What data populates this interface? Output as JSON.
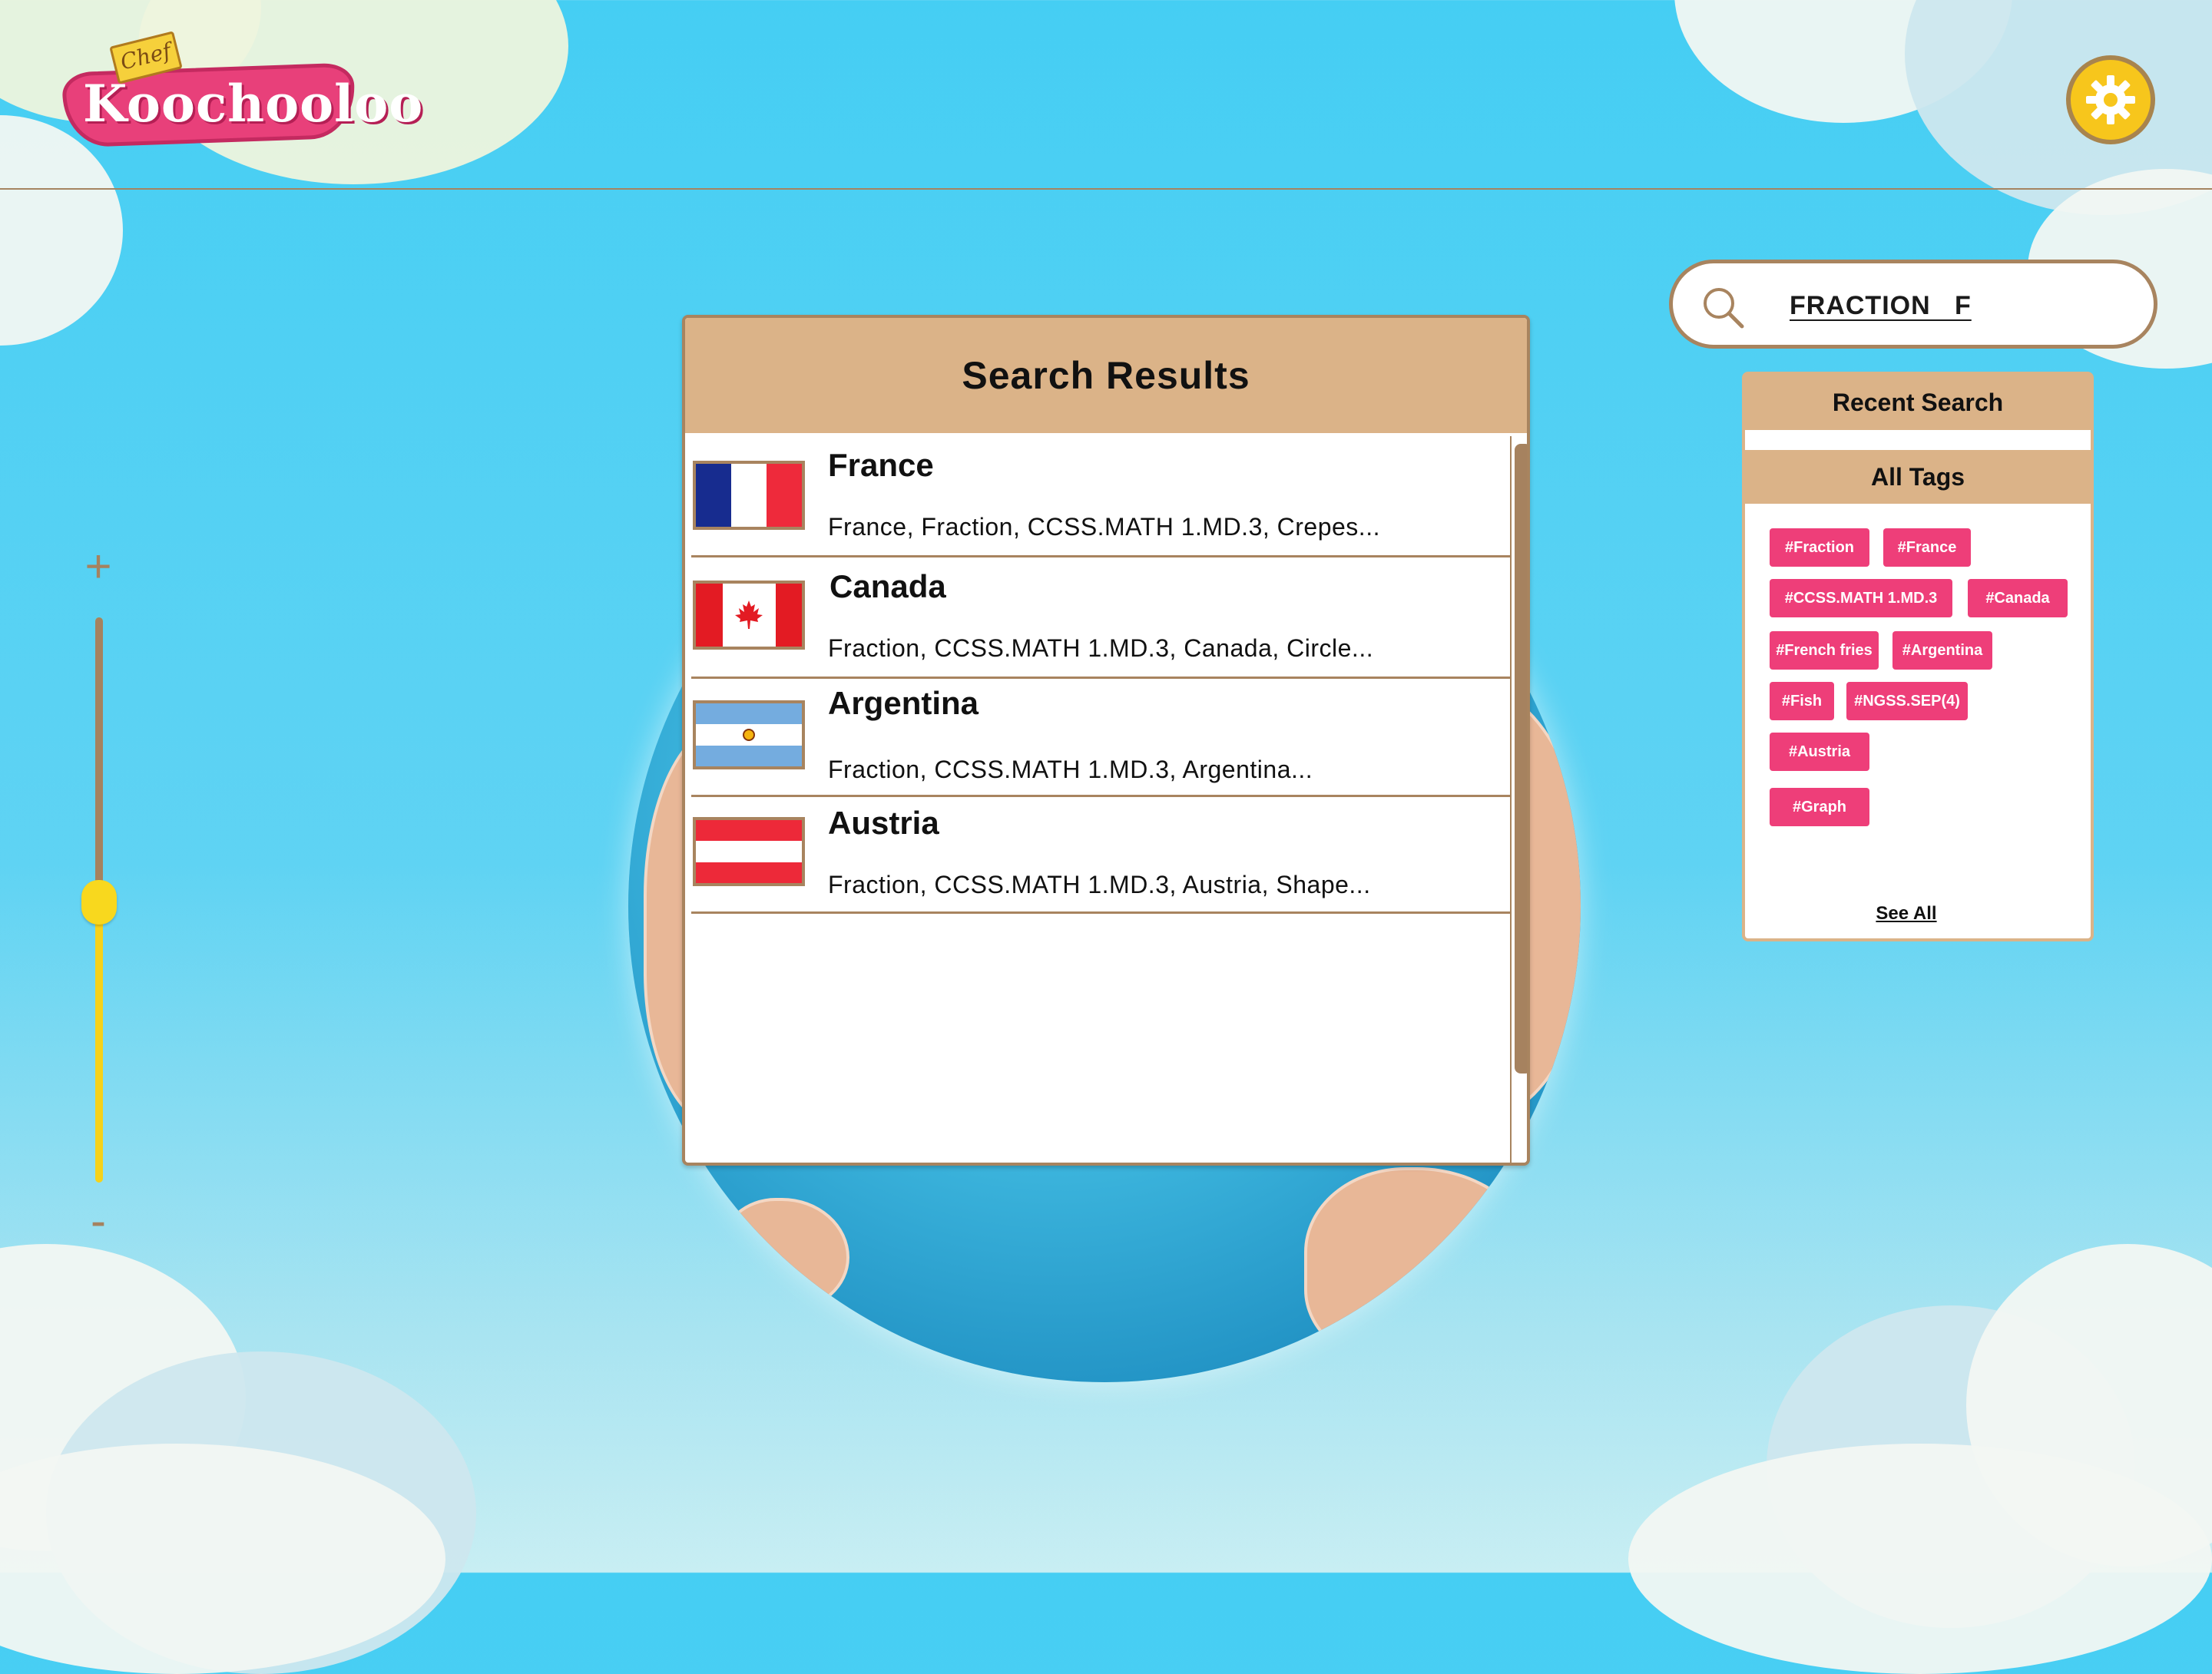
{
  "app": {
    "brand_script": "Chef",
    "brand_name": "Koochooloo"
  },
  "search": {
    "query": "FRACTION   F"
  },
  "results": {
    "title": "Search Results",
    "items": [
      {
        "country": "France",
        "tags": "France, Fraction, CCSS.MATH 1.MD.3, Crepes...",
        "flag_icon": "france-flag-icon"
      },
      {
        "country": "Canada",
        "tags": "Fraction, CCSS.MATH 1.MD.3, Canada, Circle...",
        "flag_icon": "canada-flag-icon"
      },
      {
        "country": "Argentina",
        "tags": "Fraction, CCSS.MATH 1.MD.3, Argentina...",
        "flag_icon": "argentina-flag-icon"
      },
      {
        "country": "Austria",
        "tags": "Fraction, CCSS.MATH 1.MD.3, Austria, Shape...",
        "flag_icon": "austria-flag-icon"
      }
    ]
  },
  "zoom": {
    "plus": "+",
    "minus": "-",
    "level": 0.5
  },
  "sidebar": {
    "recent_search_title": "Recent Search",
    "all_tags_title": "All Tags",
    "tags": [
      "#Fraction",
      "#France",
      "#CCSS.MATH 1.MD.3",
      "#Canada",
      "#French fries",
      "#Argentina",
      "#Fish",
      "#NGSS.SEP(4)",
      "#Austria",
      "#Graph"
    ],
    "see_all": "See All"
  },
  "colors": {
    "accent_tan": "#dbb388",
    "border_brown": "#a8845f",
    "tag_pink": "#ee3e79",
    "gear_yellow": "#f7c61c"
  }
}
